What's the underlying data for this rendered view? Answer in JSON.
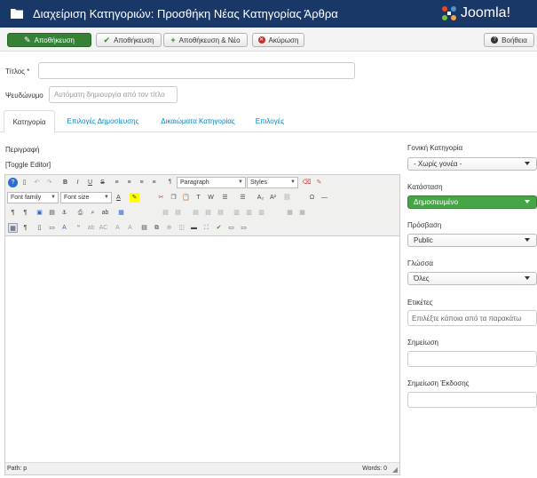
{
  "header": {
    "title": "Διαχείριση Κατηγοριών: Προσθήκη Νέας Κατηγορίας Άρθρα",
    "logo_text": "Joomla!",
    "bg_color": "#1a3867"
  },
  "toolbar": {
    "save_label": "Αποθήκευση",
    "save_close_label": "Αποθήκευση",
    "save_new_label": "Αποθήκευση & Νέο",
    "cancel_label": "Ακύρωση",
    "help_label": "Βοήθεια"
  },
  "form": {
    "title_label": "Τίτλος *",
    "title_value": "",
    "alias_label": "Ψευδώνυμο",
    "alias_placeholder": "Αυτόματη δημιουργία από τον τίτλο"
  },
  "tabs": [
    {
      "label": "Κατηγορία",
      "active": true
    },
    {
      "label": "Επιλογές Δημοσίευσης",
      "active": false
    },
    {
      "label": "Δικαιώματα Κατηγορίας",
      "active": false
    },
    {
      "label": "Επιλογές",
      "active": false
    }
  ],
  "editor": {
    "description_label": "Περιγραφή",
    "toggle_label": "[Toggle Editor]",
    "format_select": "Paragraph",
    "styles_select": "Styles",
    "font_family_select": "Font family",
    "font_size_select": "Font size",
    "path_label": "Path: p",
    "words_label": "Words: 0"
  },
  "sidebar": {
    "parent_label": "Γονική Κατηγορία",
    "parent_value": "- Χωρίς γονέα -",
    "status_label": "Κατάσταση",
    "status_value": "Δημοσιευμένο",
    "access_label": "Πρόσβαση",
    "access_value": "Public",
    "language_label": "Γλώσσα",
    "language_value": "Όλες",
    "tags_label": "Ετικέτες",
    "tags_placeholder": "Επιλέξτε κάποια από τα παρακάτω",
    "note_label": "Σημείωση",
    "note_value": "",
    "version_note_label": "Σημείωση Έκδοσης",
    "version_note_value": "",
    "status_color": "#46a546"
  }
}
